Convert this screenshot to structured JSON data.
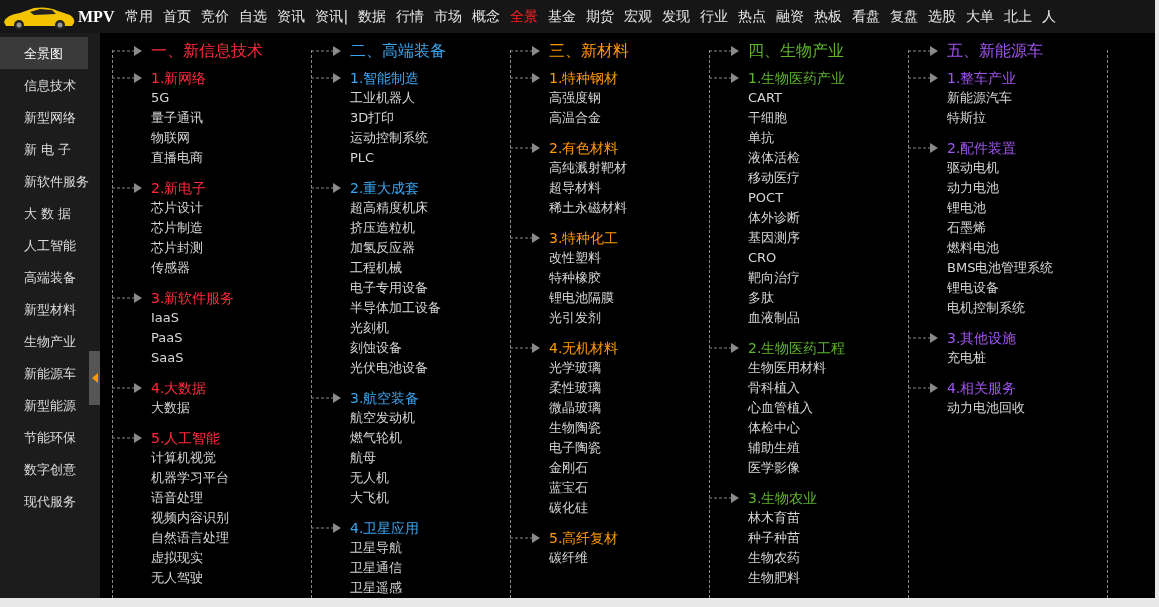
{
  "app": {
    "title": "MPV"
  },
  "menu": [
    {
      "label": "常用",
      "selected": false
    },
    {
      "label": "首页",
      "selected": false
    },
    {
      "label": "竞价",
      "selected": false
    },
    {
      "label": "自选",
      "selected": false
    },
    {
      "label": "资讯",
      "selected": false
    },
    {
      "label": "资讯|",
      "selected": false
    },
    {
      "label": "数据",
      "selected": false
    },
    {
      "label": "行情",
      "selected": false
    },
    {
      "label": "市场",
      "selected": false
    },
    {
      "label": "概念",
      "selected": false
    },
    {
      "label": "全景",
      "selected": true
    },
    {
      "label": "基金",
      "selected": false
    },
    {
      "label": "期货",
      "selected": false
    },
    {
      "label": "宏观",
      "selected": false
    },
    {
      "label": "发现",
      "selected": false
    },
    {
      "label": "行业",
      "selected": false
    },
    {
      "label": "热点",
      "selected": false
    },
    {
      "label": "融资",
      "selected": false
    },
    {
      "label": "热板",
      "selected": false
    },
    {
      "label": "看盘",
      "selected": false
    },
    {
      "label": "复盘",
      "selected": false
    },
    {
      "label": "选股",
      "selected": false
    },
    {
      "label": "大单",
      "selected": false
    },
    {
      "label": "北上",
      "selected": false
    },
    {
      "label": "人",
      "selected": false
    }
  ],
  "sidebar": {
    "items": [
      {
        "label": "全景图",
        "selected": true
      },
      {
        "label": "信息技术",
        "selected": false
      },
      {
        "label": "新型网络",
        "selected": false
      },
      {
        "label": "新 电 子",
        "selected": false
      },
      {
        "label": "新软件服务",
        "selected": false
      },
      {
        "label": "大 数 据",
        "selected": false
      },
      {
        "label": "人工智能",
        "selected": false
      },
      {
        "label": "高端装备",
        "selected": false
      },
      {
        "label": "新型材料",
        "selected": false
      },
      {
        "label": "生物产业",
        "selected": false
      },
      {
        "label": "新能源车",
        "selected": false
      },
      {
        "label": "新型能源",
        "selected": false
      },
      {
        "label": "节能环保",
        "selected": false
      },
      {
        "label": "数字创意",
        "selected": false
      },
      {
        "label": "现代服务",
        "selected": false
      }
    ]
  },
  "categories": [
    {
      "title": "一、新信息技术",
      "color": "#ff2b3a",
      "groups": [
        {
          "title": "1.新网络",
          "items": [
            "5G",
            "量子通讯",
            "物联网",
            "直播电商"
          ]
        },
        {
          "title": "2.新电子",
          "items": [
            "芯片设计",
            "芯片制造",
            "芯片封测",
            "传感器"
          ]
        },
        {
          "title": "3.新软件服务",
          "items": [
            "IaaS",
            "PaaS",
            "SaaS"
          ]
        },
        {
          "title": "4.大数据",
          "items": [
            "大数据"
          ]
        },
        {
          "title": "5.人工智能",
          "items": [
            "计算机视觉",
            "机器学习平台",
            "语音处理",
            "视频内容识别",
            "自然语言处理",
            "虚拟现实",
            "无人驾驶"
          ]
        }
      ]
    },
    {
      "title": "二、高端装备",
      "color": "#3aa4ee",
      "groups": [
        {
          "title": "1.智能制造",
          "items": [
            "工业机器人",
            "3D打印",
            "运动控制系统",
            "PLC"
          ]
        },
        {
          "title": "2.重大成套",
          "items": [
            "超高精度机床",
            "挤压造粒机",
            "加氢反应器",
            "工程机械",
            "电子专用设备",
            "半导体加工设备",
            "光刻机",
            "刻蚀设备",
            "光伏电池设备"
          ]
        },
        {
          "title": "3.航空装备",
          "items": [
            "航空发动机",
            "燃气轮机",
            "航母",
            "无人机",
            "大飞机"
          ]
        },
        {
          "title": "4.卫星应用",
          "items": [
            "卫星导航",
            "卫星通信",
            "卫星遥感"
          ]
        }
      ]
    },
    {
      "title": "三、新材料",
      "color": "#ff9a00",
      "groups": [
        {
          "title": "1.特种钢材",
          "items": [
            "高强度钢",
            "高温合金"
          ]
        },
        {
          "title": "2.有色材料",
          "items": [
            "高纯溅射靶材",
            "超导材料",
            "稀土永磁材料"
          ]
        },
        {
          "title": "3.特种化工",
          "items": [
            "改性塑料",
            "特种橡胶",
            "锂电池隔膜",
            "光引发剂"
          ]
        },
        {
          "title": "4.无机材料",
          "items": [
            "光学玻璃",
            "柔性玻璃",
            "微晶玻璃",
            "生物陶瓷",
            "电子陶瓷",
            "金刚石",
            "蓝宝石",
            "碳化硅"
          ]
        },
        {
          "title": "5.高纤复材",
          "items": [
            "碳纤维"
          ]
        }
      ]
    },
    {
      "title": "四、生物产业",
      "color": "#5db52c",
      "groups": [
        {
          "title": "1.生物医药产业",
          "items": [
            "CART",
            "干细胞",
            "单抗",
            "液体活检",
            "移动医疗",
            "POCT",
            "体外诊断",
            "基因测序",
            "CRO",
            "靶向治疗",
            "多肽",
            "血液制品"
          ]
        },
        {
          "title": "2.生物医药工程",
          "items": [
            "生物医用材料",
            "骨科植入",
            "心血管植入",
            "体检中心",
            "辅助生殖",
            "医学影像"
          ]
        },
        {
          "title": "3.生物农业",
          "items": [
            "林木育苗",
            "种子种苗",
            "生物农药",
            "生物肥料"
          ]
        }
      ]
    },
    {
      "title": "五、新能源车",
      "color": "#a054ee",
      "groups": [
        {
          "title": "1.整车产业",
          "items": [
            "新能源汽车",
            "特斯拉"
          ]
        },
        {
          "title": "2.配件装置",
          "items": [
            "驱动电机",
            "动力电池",
            "锂电池",
            "石墨烯",
            "燃料电池",
            "BMS电池管理系统",
            "锂电设备",
            "电机控制系统"
          ]
        },
        {
          "title": "3.其他设施",
          "items": [
            "充电桩"
          ]
        },
        {
          "title": "4.相关服务",
          "items": [
            "动力电池回收"
          ]
        }
      ]
    }
  ]
}
